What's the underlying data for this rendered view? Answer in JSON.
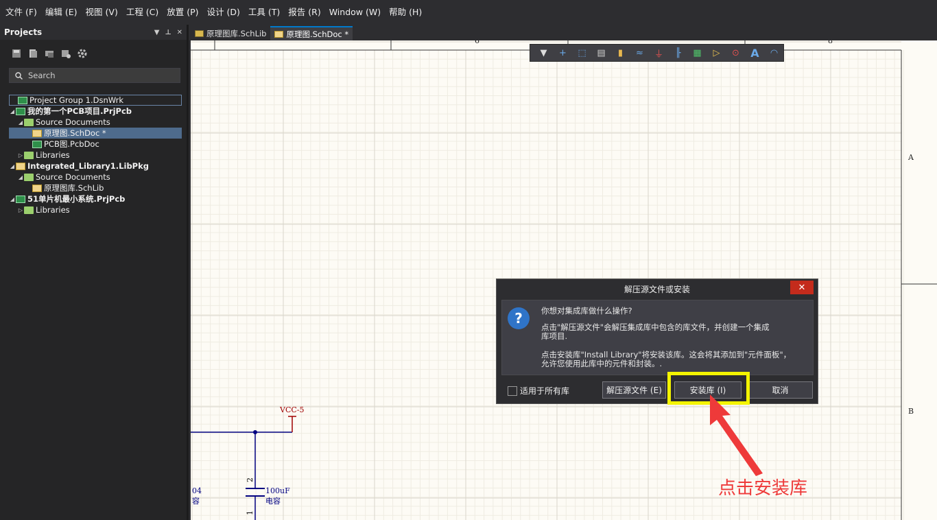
{
  "menu": [
    "文件 (F)",
    "编辑 (E)",
    "视图 (V)",
    "工程 (C)",
    "放置 (P)",
    "设计 (D)",
    "工具 (T)",
    "报告 (R)",
    "Window (W)",
    "帮助 (H)"
  ],
  "projects_panel": {
    "title": "Projects",
    "header_icons": [
      "▼",
      "⊥",
      "✕"
    ],
    "search_placeholder": "Search",
    "tree": [
      {
        "label": "Project Group 1.DsnWrk",
        "level": 0,
        "icon": "workspace-icon",
        "bold": false,
        "arrow": ""
      },
      {
        "label": "我的第一个PCB项目.PrjPcb",
        "level": 0,
        "icon": "pcb-project-icon",
        "bold": true,
        "arrow": "◢"
      },
      {
        "label": "Source Documents",
        "level": 1,
        "icon": "folder-icon",
        "bold": false,
        "arrow": "◢"
      },
      {
        "label": "原理图.SchDoc *",
        "level": 2,
        "icon": "schdoc-icon",
        "bold": false,
        "arrow": "",
        "selected": true
      },
      {
        "label": "PCB图.PcbDoc",
        "level": 2,
        "icon": "pcbdoc-icon",
        "bold": false,
        "arrow": ""
      },
      {
        "label": "Libraries",
        "level": 1,
        "icon": "folder-icon",
        "bold": false,
        "arrow": "▷"
      },
      {
        "label": "Integrated_Library1.LibPkg",
        "level": 0,
        "icon": "libpkg-icon",
        "bold": true,
        "arrow": "◢"
      },
      {
        "label": "Source Documents",
        "level": 1,
        "icon": "folder-icon",
        "bold": false,
        "arrow": "◢"
      },
      {
        "label": "原理图库.SchLib",
        "level": 2,
        "icon": "schlib-icon",
        "bold": false,
        "arrow": ""
      },
      {
        "label": "51单片机最小系统.PrjPcb",
        "level": 0,
        "icon": "pcb-project-icon",
        "bold": true,
        "arrow": "◢"
      },
      {
        "label": "Libraries",
        "level": 1,
        "icon": "folder-icon",
        "bold": false,
        "arrow": "▷"
      }
    ]
  },
  "tabs": [
    {
      "label": "原理图库.SchLib",
      "active": false
    },
    {
      "label": "原理图.SchDoc *",
      "active": true
    }
  ],
  "canvas": {
    "border_letters": [
      "A",
      "B"
    ],
    "ruler_numbers": [
      "6",
      "8"
    ],
    "net_label": "VCC-5",
    "cap_value": "100uF",
    "cap_name": "电容",
    "pin_top": "2",
    "pin_bottom": "1",
    "left_partial_top": "04",
    "left_partial_bottom": "容"
  },
  "float_toolbar": [
    "filter-icon",
    "cross-icon",
    "select-icon",
    "align-icon",
    "component-icon",
    "wire-icon",
    "ground-icon",
    "bus-icon",
    "part-icon",
    "port-icon",
    "directive-icon",
    "text-icon",
    "arc-icon"
  ],
  "dialog": {
    "title": "解压源文件或安装",
    "close": "✕",
    "question": "你想对集成库做什么操作?",
    "para1": "点击\"解压源文件\"会解压集成库中包含的库文件，并创建一个集成库项目.",
    "para2": "点击安装库\"Install Library\"将安装该库。这会将其添加到\"元件面板\"，允许您使用此库中的元件和封装。.",
    "checkbox_label": "适用于所有库",
    "extract_button": "解压源文件 (E)",
    "install_button": "安装库 (I)",
    "cancel_button": "取消"
  },
  "annotation": "点击安装库",
  "colors": {
    "highlight": "#f4f400",
    "annotation": "#ee3a3a",
    "accent": "#007acc"
  }
}
